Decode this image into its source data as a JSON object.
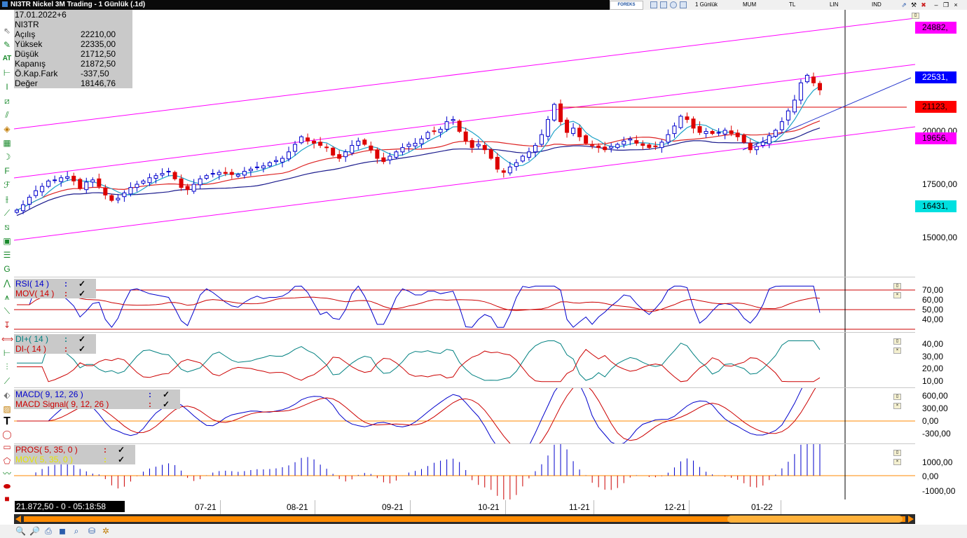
{
  "window": {
    "title": "NI3TR Nickel 3M Trading - 1 Günlük (.1d)",
    "brand": "FOREKS",
    "period": "1 Günlük",
    "chart_style": "MUM",
    "currency": "TL",
    "scale": "LIN",
    "indicator_button": "IND"
  },
  "info": {
    "date": "17.01.2022+6",
    "symbol": "NI3TR",
    "rows": [
      {
        "label": "Açılış",
        "value": "22210,00"
      },
      {
        "label": "Yüksek",
        "value": "22335,00"
      },
      {
        "label": "Düşük",
        "value": "21712,50"
      },
      {
        "label": "Kapanış",
        "value": "21872,50"
      },
      {
        "label": "Ö.Kap.Fark",
        "value": "-337,50"
      },
      {
        "label": "Değer",
        "value": "18146,76"
      }
    ]
  },
  "price_axis": {
    "labels": [
      "20000,00",
      "17500,00",
      "15000,00"
    ],
    "boxes": [
      {
        "text": "24882,",
        "bg": "#ff00ff",
        "color": "#000000"
      },
      {
        "text": "22531,",
        "bg": "#0000ff",
        "color": "#ffffff"
      },
      {
        "text": "21123,",
        "bg": "#ff0000",
        "color": "#000000"
      },
      {
        "text": "19656,",
        "bg": "#ff00ff",
        "color": "#000000"
      },
      {
        "text": "16431,",
        "bg": "#00e0e0",
        "color": "#000000"
      }
    ]
  },
  "indicators": {
    "rsi": {
      "legend": [
        {
          "name": "RSI( 14 )",
          "sep": ":",
          "check": "✓",
          "color": "#0000cc"
        },
        {
          "name": "MOV( 14 )",
          "sep": ":",
          "check": "✓",
          "color": "#cc0000"
        }
      ],
      "axis": [
        "70,00",
        "60,00",
        "50,00",
        "40,00"
      ]
    },
    "di": {
      "legend": [
        {
          "name": "DI+( 14 )",
          "sep": ":",
          "check": "✓",
          "color": "#008080"
        },
        {
          "name": "DI-( 14 )",
          "sep": ":",
          "check": "✓",
          "color": "#cc0000"
        }
      ],
      "axis": [
        "40,00",
        "30,00",
        "20,00",
        "10,00"
      ]
    },
    "macd": {
      "legend": [
        {
          "name": "MACD( 9, 12, 26 )",
          "sep": ":",
          "check": "✓",
          "color": "#0000cc"
        },
        {
          "name": "MACD Signal( 9, 12, 26 )",
          "sep": ":",
          "check": "✓",
          "color": "#cc0000"
        }
      ],
      "axis": [
        "600,00",
        "300,00",
        "0,00",
        "-300,00"
      ]
    },
    "pros": {
      "legend": [
        {
          "name": "PROS( 5, 35, 0 )",
          "sep": ":",
          "check": "✓",
          "color": "#cc0000"
        },
        {
          "name": "MOV( 5, 35, 0 )",
          "sep": ":",
          "check": "✓",
          "color": "#e6e600"
        }
      ],
      "axis": [
        "1000,00",
        "0,00",
        "-1000,00"
      ]
    }
  },
  "date_axis": [
    "07-21",
    "08-21",
    "09-21",
    "10-21",
    "11-21",
    "12-21",
    "01-22"
  ],
  "status": "21.872,50 - 0 - 05:18:58",
  "colors": {
    "channel": "#ff00ff",
    "ma_fast": "#1fa3c8",
    "ma_slow": "#1a1a8c",
    "ma_mid": "#dd2222",
    "bull": "#0000cc",
    "bear": "#dd0000",
    "support": "#dd0000",
    "trendline": "#2233cc"
  },
  "chart_data": {
    "type": "candlestick",
    "x_range": [
      "2021-06",
      "2022-01"
    ],
    "ylim": [
      14000,
      26000
    ],
    "close_series_est": [
      16300,
      16550,
      16900,
      17200,
      17400,
      17650,
      17700,
      17800,
      17850,
      17650,
      17300,
      17600,
      17700,
      17400,
      17000,
      16750,
      16850,
      17100,
      17350,
      17500,
      17650,
      17800,
      17900,
      18000,
      18100,
      17750,
      17350,
      17250,
      17500,
      17750,
      17900,
      18000,
      18050,
      18000,
      17950,
      17950,
      18100,
      18200,
      18300,
      18350,
      18500,
      18600,
      18700,
      19000,
      19350,
      19700,
      19500,
      19400,
      19300,
      19200,
      18850,
      18700,
      19000,
      19300,
      19500,
      19350,
      19100,
      18700,
      18550,
      18800,
      19000,
      19200,
      19350,
      19400,
      19600,
      19900,
      19950,
      20050,
      20400,
      20500,
      19950,
      19500,
      19200,
      19350,
      19100,
      18700,
      18200,
      18050,
      18300,
      18500,
      18800,
      19000,
      19300,
      19800,
      20500,
      21200,
      20400,
      19900,
      20100,
      19700,
      19400,
      19300,
      19200,
      19100,
      19250,
      19350,
      19500,
      19600,
      19400,
      19300,
      19200,
      19250,
      19450,
      19800,
      20200,
      20650,
      20500,
      20100,
      19900,
      19950,
      19850,
      19900,
      20000,
      19850,
      19700,
      19450,
      19100,
      19250,
      19450,
      19750,
      20000,
      20400,
      20900,
      21400,
      22200,
      22550,
      22200,
      21872
    ]
  }
}
